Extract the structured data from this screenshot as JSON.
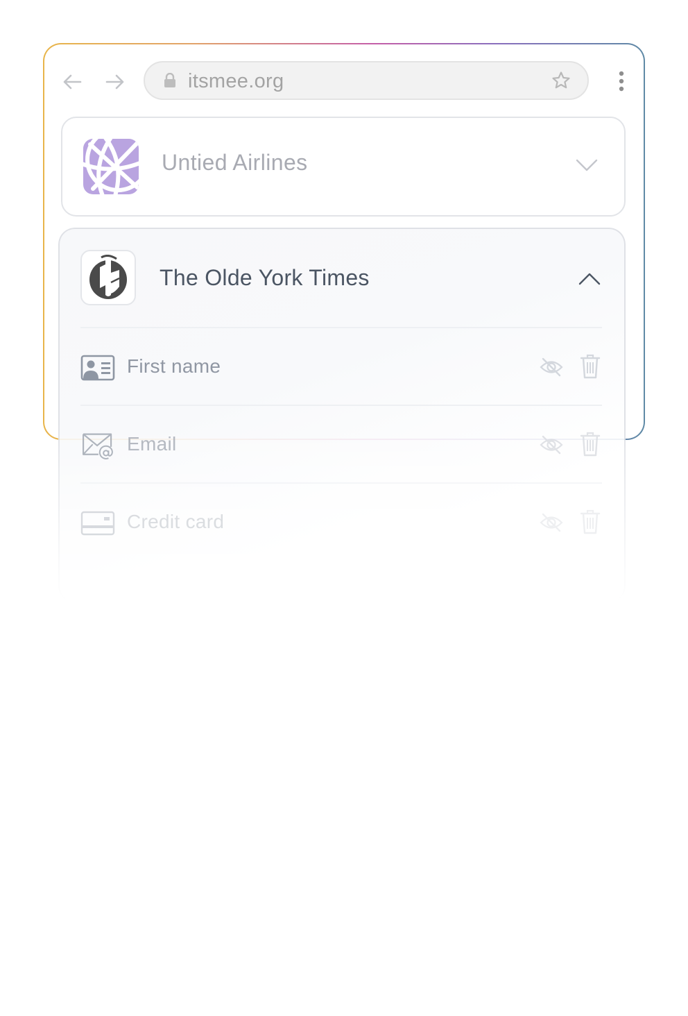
{
  "browser": {
    "url": "itsmee.org",
    "back_icon": "arrow-left-icon",
    "forward_icon": "arrow-right-icon",
    "lock_icon": "lock-icon",
    "bookmark_icon": "star-icon",
    "menu_icon": "more-vertical-icon"
  },
  "accounts": [
    {
      "name": "Untied Airlines",
      "icon": "globe-logo-icon",
      "expanded": false,
      "accent": "#b9a4e0"
    },
    {
      "name": "The Olde York Times",
      "icon": "newspaper-logo-icon",
      "expanded": true,
      "fields": [
        {
          "label": "First name",
          "icon": "id-card-icon"
        },
        {
          "label": "Email",
          "icon": "email-at-icon"
        },
        {
          "label": "Credit card",
          "icon": "credit-card-icon"
        }
      ]
    }
  ],
  "colors": {
    "frame_gradient": [
      "#e8b54a",
      "#c45fa8",
      "#5f8aa6"
    ],
    "muted_text": "#a8aab2",
    "strong_text": "#4b5563"
  }
}
